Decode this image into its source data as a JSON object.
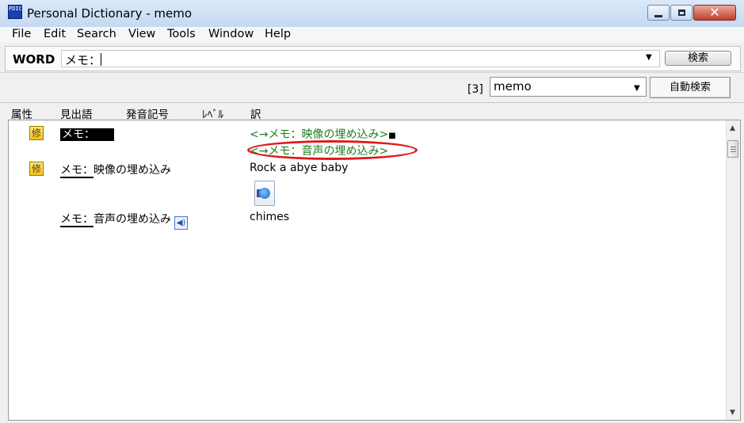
{
  "window": {
    "title": "Personal Dictionary - memo",
    "app_icon_text": "PDIC"
  },
  "menu": [
    "File",
    "Edit",
    "Search",
    "View",
    "Tools",
    "Window",
    "Help"
  ],
  "word_bar": {
    "label": "WORD",
    "input_value": "メモ：",
    "search_button": "検索"
  },
  "toolbar": {
    "count": "[3]",
    "dictionary": "memo",
    "auto_search": "自動検索"
  },
  "columns": [
    "属性",
    "見出語",
    "発音記号",
    "ﾚﾍﾞﾙ",
    "訳"
  ],
  "entries": [
    {
      "badge": "修",
      "headword": "メモ：",
      "translation_links": [
        "<→メモ：映像の埋め込み>",
        "<→メモ：音声の埋め込み>"
      ],
      "end_mark": "■"
    },
    {
      "badge": "修",
      "headword": "メモ：映像の埋め込み",
      "translation": "Rock a abye baby",
      "media_icon": "audio-file-icon"
    },
    {
      "headword": "メモ：音声の埋め込み",
      "translation": "chimes",
      "speaker_icon": "speaker-icon"
    }
  ],
  "colors": {
    "link_green": "#1e7d1e",
    "annotation_red": "#e0191b",
    "badge_yellow": "#f4c320"
  }
}
